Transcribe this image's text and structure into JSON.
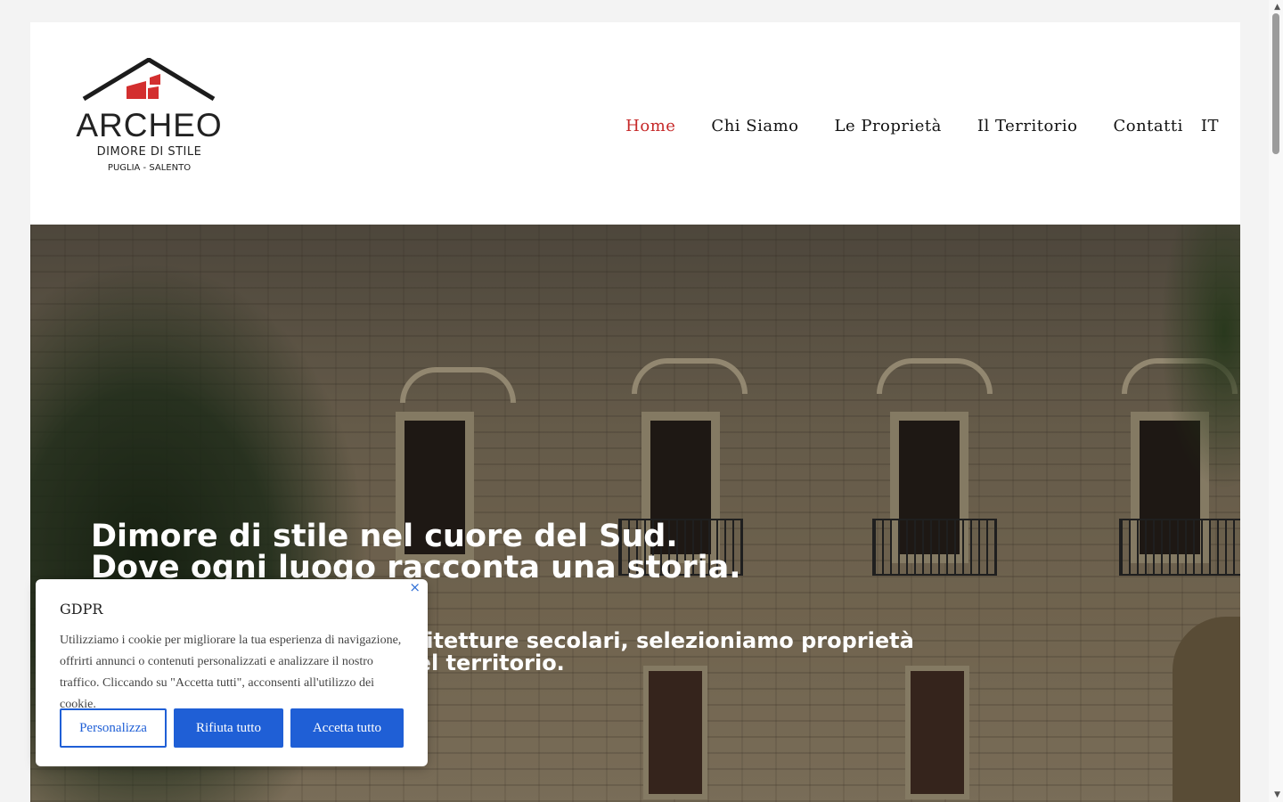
{
  "logo": {
    "title": "ARCHEO",
    "subtitle": "DIMORE DI STILE",
    "location": "PUGLIA - SALENTO",
    "accent_color": "#d32f2f",
    "roof_color": "#1c1c1c"
  },
  "nav": {
    "items": [
      {
        "label": "Home",
        "active": true
      },
      {
        "label": "Chi Siamo"
      },
      {
        "label": "Le Proprietà"
      },
      {
        "label": "Il Territorio"
      },
      {
        "label": "Contatti"
      }
    ],
    "language": "IT",
    "active_color": "#c62828"
  },
  "hero": {
    "title_line1": "Dimore di stile nel cuore del Sud.",
    "title_line2": "Dove ogni luogo racconta una storia.",
    "subtitle_line1": "Tra masserie, palazzi e architetture secolari, selezioniamo proprietà",
    "subtitle_line2": "che custodiscono l'anima del territorio."
  },
  "gdpr": {
    "title": "GDPR",
    "close_icon": "×",
    "text": "Utilizziamo i cookie per migliorare la tua esperienza di navigazione, offrirti annunci o contenuti personalizzati e analizzare il nostro traffico. Cliccando su \"Accetta tutti\", acconsenti all'utilizzo dei cookie.",
    "buttons": {
      "customize": "Personalizza",
      "reject": "Rifiuta tutto",
      "accept": "Accetta tutto"
    },
    "button_color": "#1f5fd6"
  },
  "scrollbar": {
    "up_icon": "▲",
    "down_icon": "▼"
  }
}
